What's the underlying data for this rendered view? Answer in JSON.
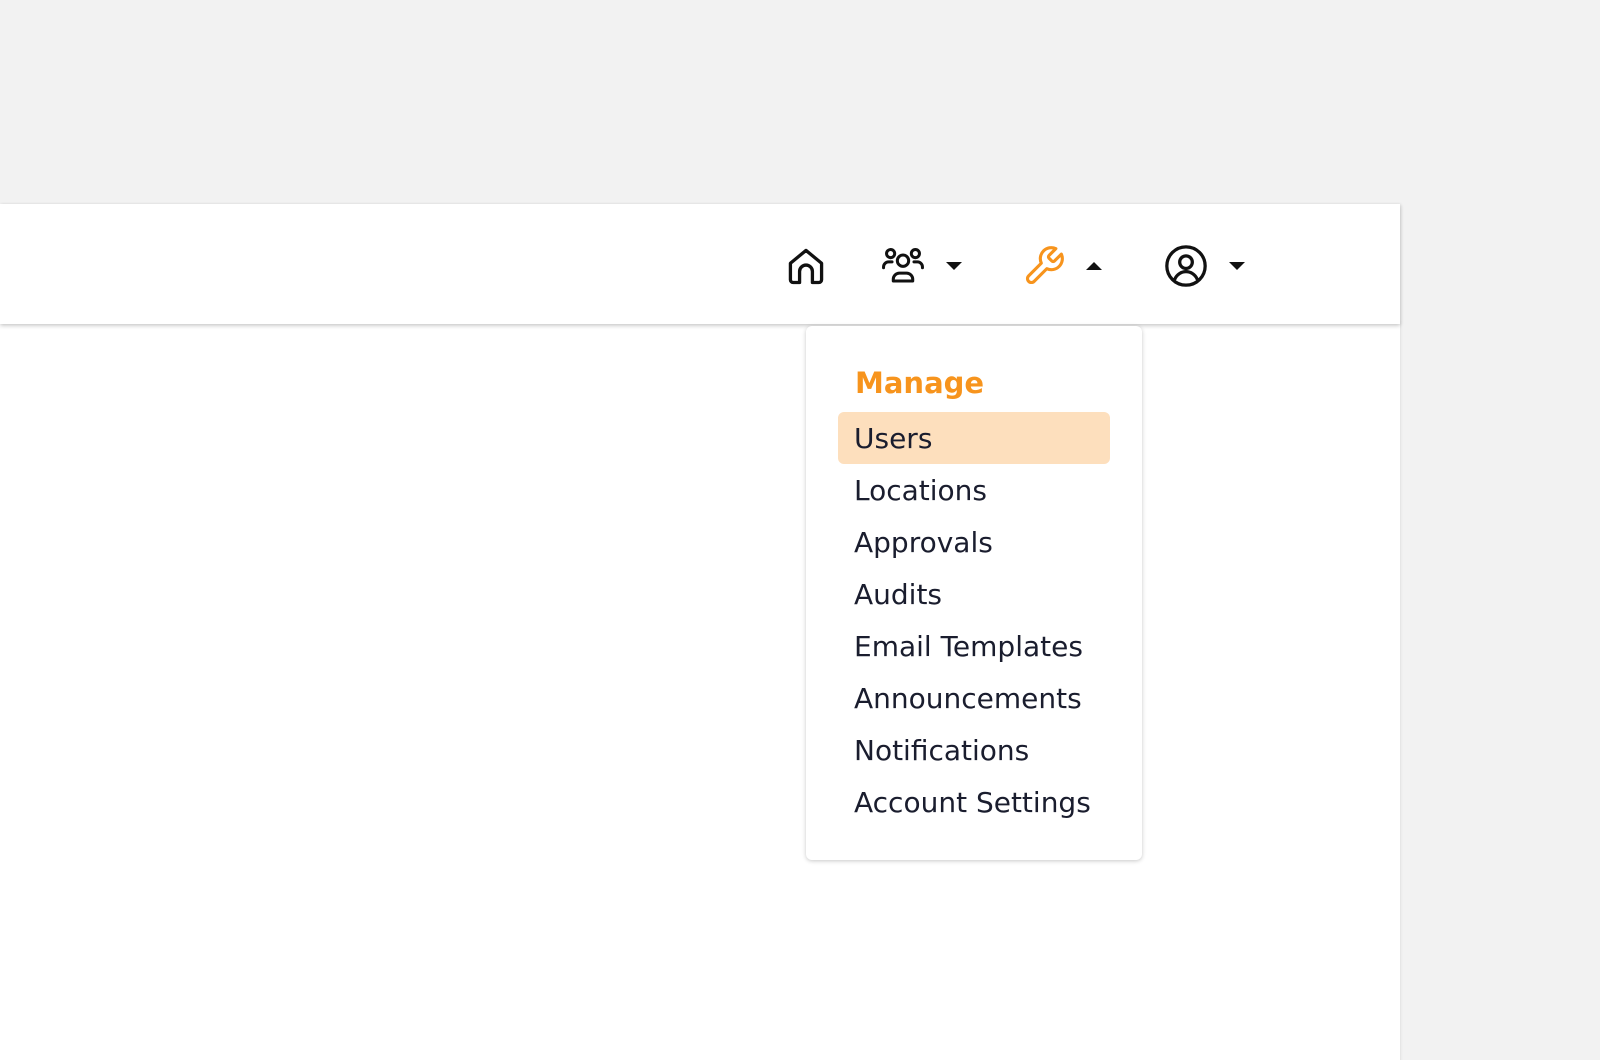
{
  "colors": {
    "accent": "#f7941d",
    "highlight": "#fddfbd",
    "text": "#1a1d2e",
    "icon": "#111111"
  },
  "topbar": {
    "items": [
      {
        "name": "home",
        "icon": "home-icon",
        "has_caret": false
      },
      {
        "name": "users",
        "icon": "users-group-icon",
        "caret": "down"
      },
      {
        "name": "manage",
        "icon": "wrench-icon",
        "caret": "up",
        "active": true
      },
      {
        "name": "account",
        "icon": "user-circle-icon",
        "caret": "down"
      }
    ]
  },
  "manage_menu": {
    "heading": "Manage",
    "items": [
      {
        "label": "Users",
        "highlighted": true
      },
      {
        "label": "Locations"
      },
      {
        "label": "Approvals"
      },
      {
        "label": "Audits"
      },
      {
        "label": "Email Templates"
      },
      {
        "label": "Announcements"
      },
      {
        "label": "Notifications"
      },
      {
        "label": "Account Settings"
      }
    ]
  }
}
